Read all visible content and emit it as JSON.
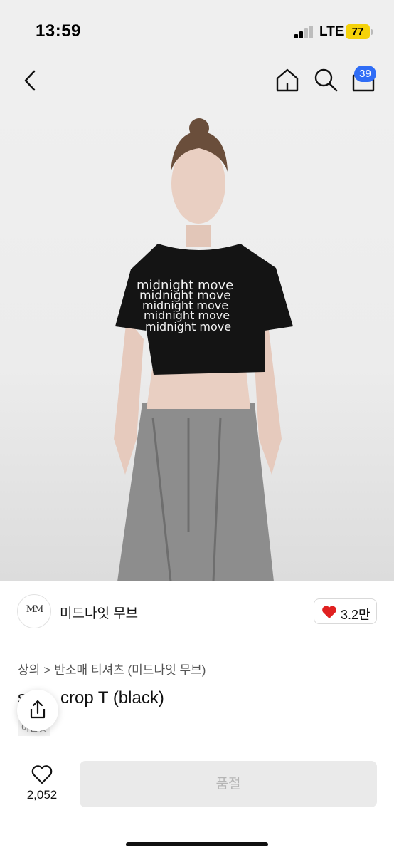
{
  "status_bar": {
    "time": "13:59",
    "network": "LTE",
    "battery": "77"
  },
  "nav": {
    "back_icon": "chevron-left-icon",
    "home_icon": "home-icon",
    "search_icon": "search-icon",
    "cart_icon": "shopping-bag-icon",
    "cart_badge": "39",
    "badge_color": "#2f6df6"
  },
  "hero": {
    "print_text": "midnight move"
  },
  "seller": {
    "logo_text": "MM",
    "name": "미드나잇 무브",
    "like_count": "3.2만",
    "heart_color": "#e02020"
  },
  "breadcrumb": {
    "category": "상의",
    "separator": ">",
    "subcategory": "반소매 티셔츠 (미드나잇 무브)"
  },
  "product": {
    "title_prefix": "s",
    "title": "crop T (black)",
    "tag": "아울렛"
  },
  "bottom_bar": {
    "wish_count": "2,052",
    "soldout_label": "품절"
  }
}
